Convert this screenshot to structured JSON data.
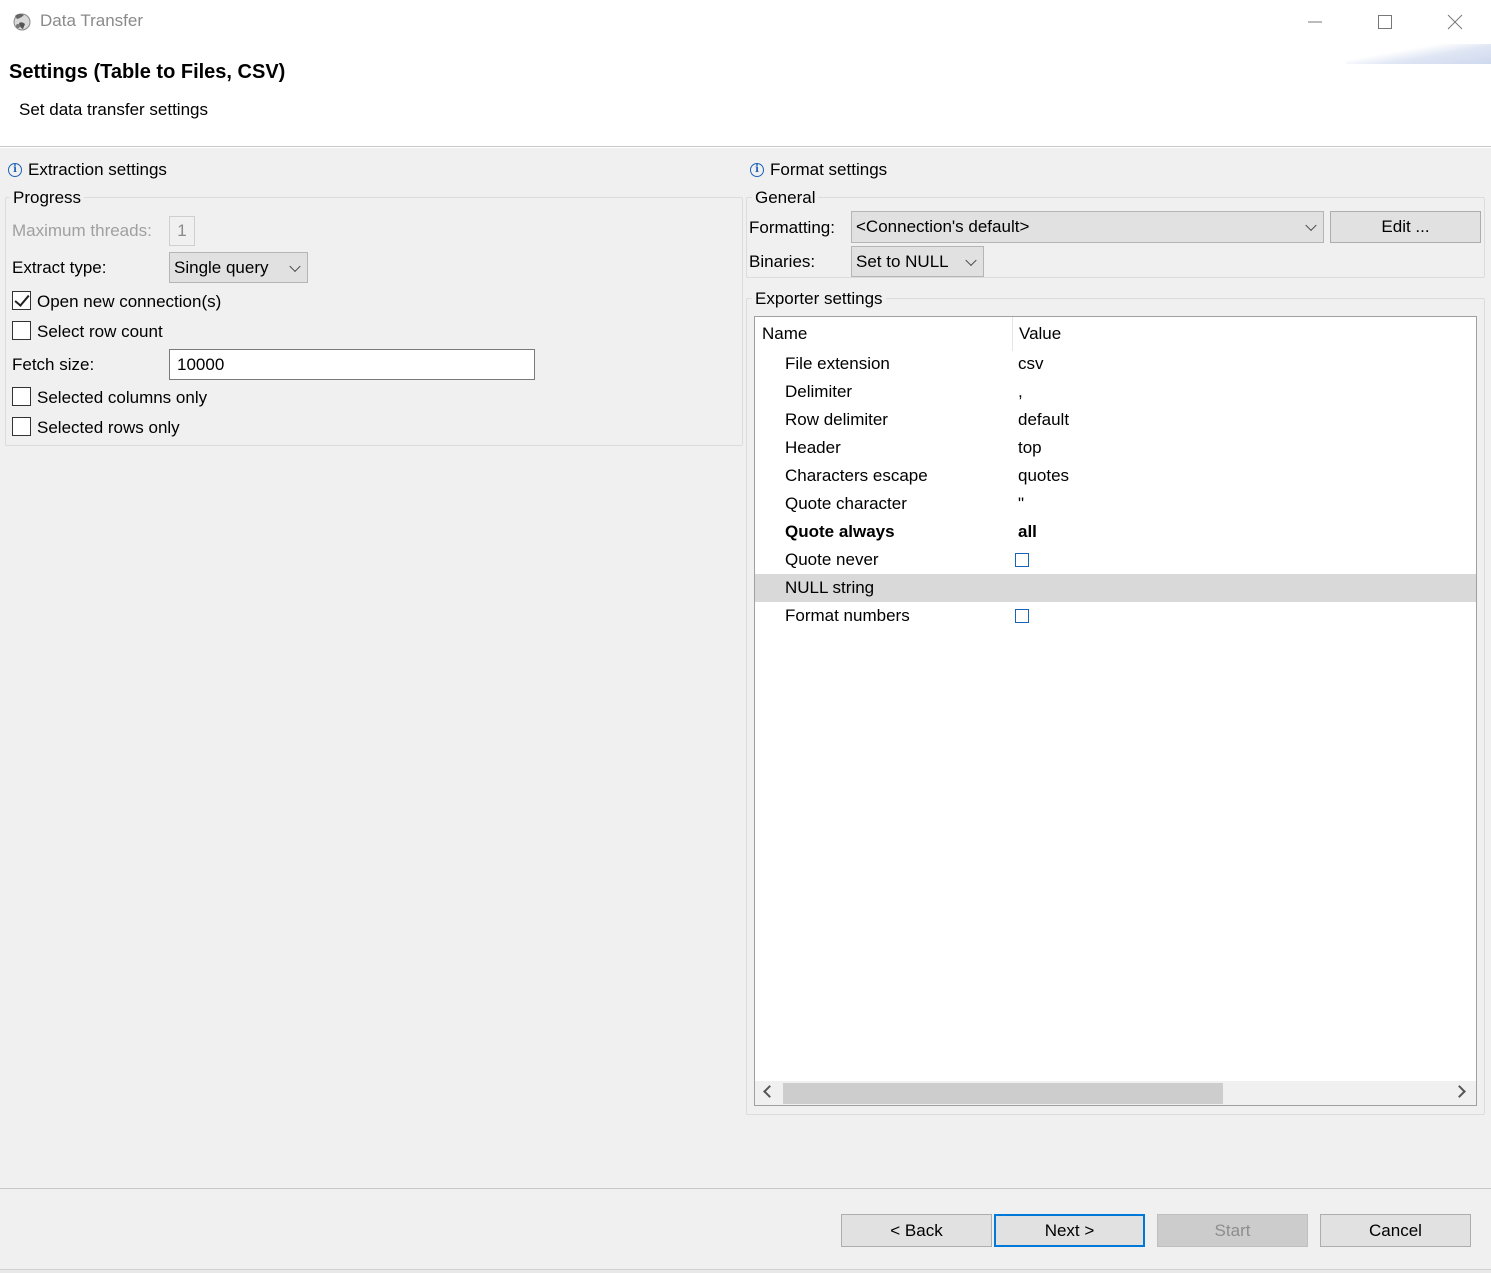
{
  "window": {
    "title": "Data Transfer"
  },
  "header": {
    "title": "Settings (Table to Files, CSV)",
    "description": "Set data transfer settings"
  },
  "extraction": {
    "section_title": "Extraction settings",
    "group_title": "Progress",
    "max_threads_label": "Maximum threads:",
    "max_threads_value": "1",
    "extract_type_label": "Extract type:",
    "extract_type_value": "Single query",
    "open_new_connections": {
      "label": "Open new connection(s)",
      "checked": true
    },
    "select_row_count": {
      "label": "Select row count",
      "checked": false
    },
    "fetch_size_label": "Fetch size:",
    "fetch_size_value": "10000",
    "selected_columns_only": {
      "label": "Selected columns only",
      "checked": false
    },
    "selected_rows_only": {
      "label": "Selected rows only",
      "checked": false
    }
  },
  "format": {
    "section_title": "Format settings",
    "general_title": "General",
    "formatting_label": "Formatting:",
    "formatting_value": "<Connection's default>",
    "edit_button": "Edit ...",
    "binaries_label": "Binaries:",
    "binaries_value": "Set to NULL",
    "exporter_title": "Exporter settings",
    "table": {
      "columns": [
        "Name",
        "Value"
      ],
      "rows": [
        {
          "name": "File extension",
          "value": "csv"
        },
        {
          "name": "Delimiter",
          "value": ","
        },
        {
          "name": "Row delimiter",
          "value": "default"
        },
        {
          "name": "Header",
          "value": "top"
        },
        {
          "name": "Characters escape",
          "value": "quotes"
        },
        {
          "name": "Quote character",
          "value": "\""
        },
        {
          "name": "Quote always",
          "value": "all"
        },
        {
          "name": "Quote never",
          "value": ""
        },
        {
          "name": "NULL string",
          "value": ""
        },
        {
          "name": "Format numbers",
          "value": ""
        }
      ]
    }
  },
  "footer": {
    "back": "< Back",
    "next": "Next >",
    "start": "Start",
    "cancel": "Cancel"
  },
  "colors": {
    "accent": "#0078d7",
    "dialog_bg": "#f0f0f0",
    "info_blue": "#1a62b8",
    "selected_row": "#d9d9d9"
  }
}
